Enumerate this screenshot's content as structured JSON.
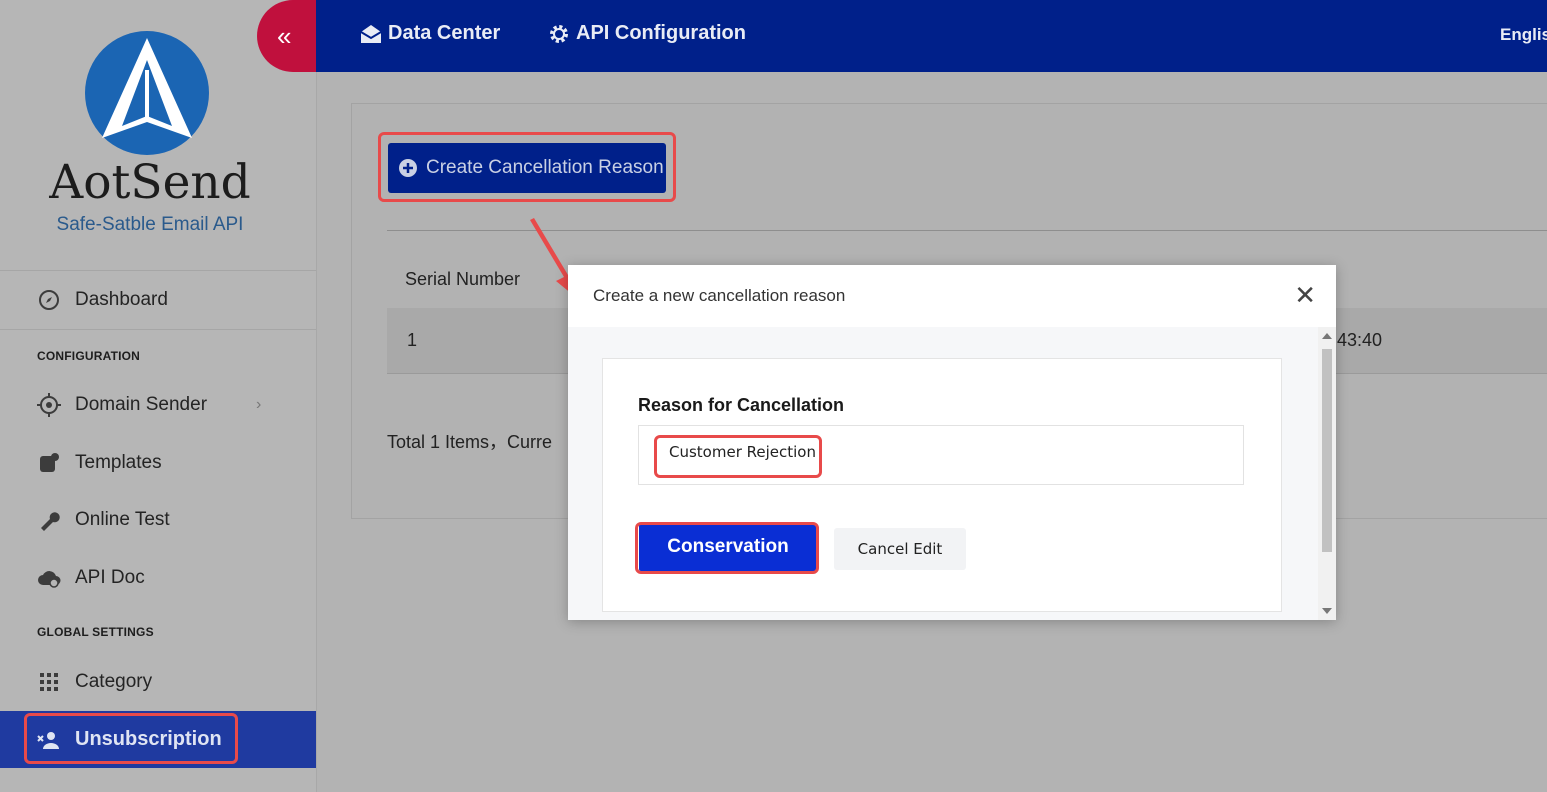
{
  "brand": {
    "name": "AotSend",
    "tagline": "Safe-Satble Email API"
  },
  "sidebar": {
    "collapse_icon": "double-chevron-left-icon",
    "dashboard": {
      "label": "Dashboard",
      "icon": "compass-icon"
    },
    "section_config": "CONFIGURATION",
    "config_items": [
      {
        "label": "Domain Sender",
        "icon": "crosshair-icon"
      },
      {
        "label": "Templates",
        "icon": "template-icon"
      },
      {
        "label": "Online Test",
        "icon": "wrench-icon"
      },
      {
        "label": "API Doc",
        "icon": "cloud-doc-icon"
      }
    ],
    "section_global": "GLOBAL SETTINGS",
    "global_items": [
      {
        "label": "Category",
        "icon": "grid-icon"
      },
      {
        "label": "Unsubscription",
        "icon": "user-remove-icon"
      }
    ]
  },
  "topbar": {
    "data_center": "Data Center",
    "api_config": "API Configuration",
    "language": "Englis"
  },
  "main": {
    "create_button": "Create Cancellation Reason",
    "table_header_serial": "Serial Number",
    "row_serial": "1",
    "row_time_fragment": "43:40",
    "pagination_fragment": "Total 1 Items，Curre"
  },
  "modal": {
    "title": "Create a new cancellation reason",
    "field_label": "Reason for Cancellation",
    "field_value": "Customer Rejection",
    "save_button": "Conservation",
    "cancel_button": "Cancel Edit"
  },
  "colors": {
    "topbar": "#00208a",
    "primary_button": "#0a2ed4",
    "highlight": "#e84a4a",
    "collapse_button": "#c0103d"
  }
}
